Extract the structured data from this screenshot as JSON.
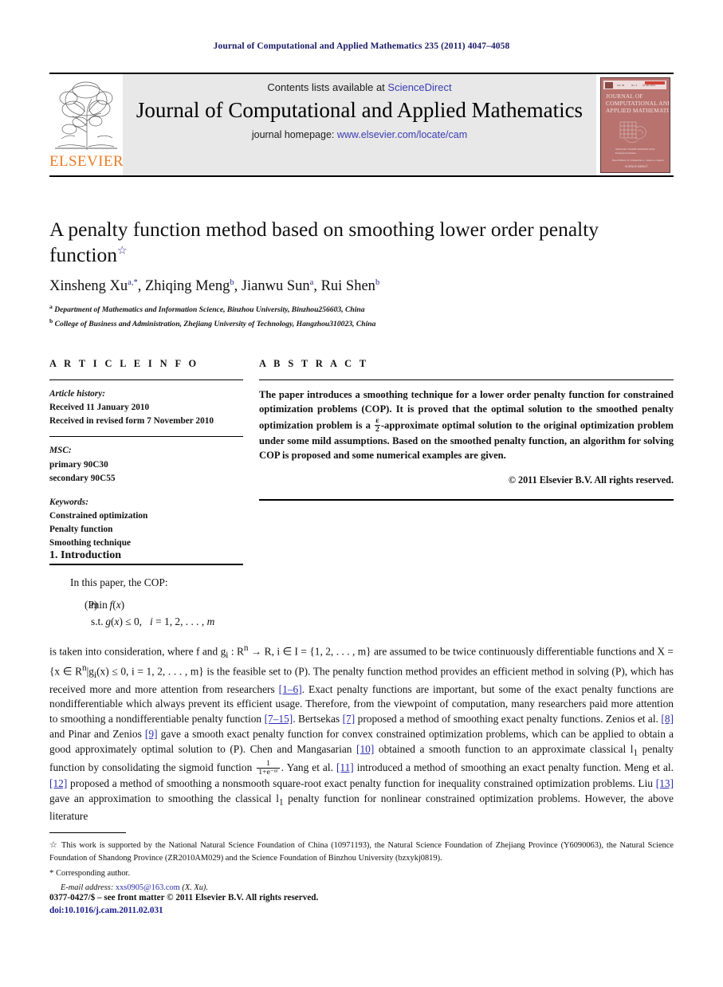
{
  "running_head": "Journal of Computational and Applied Mathematics 235 (2011) 4047–4058",
  "masthead": {
    "contents_prefix": "Contents lists available at ",
    "sciencedirect": "ScienceDirect",
    "journal_title": "Journal of Computational and Applied Mathematics",
    "homepage_prefix": "journal homepage: ",
    "homepage_url": "www.elsevier.com/locate/cam",
    "publisher": "ELSEVIER",
    "cover_title_line1": "JOURNAL OF",
    "cover_title_line2": "COMPUTATIONAL AND",
    "cover_title_line3": "APPLIED MATHEMATICS",
    "cover_caption": "Sixth Issue: Scientific Reliability Series Evaluation Problems",
    "cover_editors": "Based Editors: R. Schumacher, L. Teano, A. Veselov",
    "cover_footer": "SCIENCE DIRECT",
    "accent_link_color": "#3b3bb5",
    "elsevier_orange": "#ec7c26"
  },
  "article": {
    "title": "A penalty function method based on smoothing lower order penalty function",
    "title_star": "☆",
    "authors": [
      {
        "name": "Xinsheng Xu",
        "sup": "a,*"
      },
      {
        "name": "Zhiqing Meng",
        "sup": "b"
      },
      {
        "name": "Jianwu Sun",
        "sup": "a"
      },
      {
        "name": "Rui Shen",
        "sup": "b"
      }
    ],
    "affiliations": [
      {
        "marker": "a",
        "text": "Department of Mathematics and Information Science, Binzhou University, Binzhou256603, China"
      },
      {
        "marker": "b",
        "text": "College of Business and Administration, Zhejiang University of Technology, Hangzhou310023, China"
      }
    ]
  },
  "article_info": {
    "heading": "A R T I C L E    I N F O",
    "history_label": "Article history:",
    "history": [
      "Received 11 January 2010",
      "Received in revised form 7 November 2010"
    ],
    "msc_label": "MSC:",
    "msc": [
      "primary 90C30",
      "secondary 90C55"
    ],
    "keywords_label": "Keywords:",
    "keywords": [
      "Constrained optimization",
      "Penalty function",
      "Smoothing technique"
    ]
  },
  "abstract": {
    "heading": "A B S T R A C T",
    "text_part1": "The paper introduces a smoothing technique for a lower order penalty function for constrained optimization problems (COP). It is proved that the optimal solution to the smoothed penalty optimization problem is a ",
    "frac_num": "ε",
    "frac_den": "2",
    "text_part2": "-approximate optimal solution to the original optimization problem under some mild assumptions. Based on the smoothed penalty function, an algorithm for solving COP is proposed and some numerical examples are given.",
    "copyright": "© 2011 Elsevier B.V. All rights reserved."
  },
  "body": {
    "section_number": "1.",
    "section_title": "Introduction",
    "intro_lead": "In this paper, the COP:",
    "equation": {
      "tag": "(P)",
      "line1": "min f(x)",
      "line2_pre": "s.t. g(x) ≤ 0,",
      "line2_post": "i = 1, 2, . . . , m"
    },
    "paragraph_segments": [
      {
        "type": "text",
        "value": "is taken into consideration, where f and g"
      },
      {
        "type": "sub",
        "value": "i"
      },
      {
        "type": "text",
        "value": " : R"
      },
      {
        "type": "sup",
        "value": "n"
      },
      {
        "type": "text",
        "value": " → R, i ∈ I = {1, 2, . . . , m} are assumed to be twice continuously differentiable functions and X = {x ∈ R"
      },
      {
        "type": "sup",
        "value": "n"
      },
      {
        "type": "text",
        "value": "|g"
      },
      {
        "type": "sub",
        "value": "i"
      },
      {
        "type": "text",
        "value": "(x) ≤ 0, i = 1, 2, . . . , m} is the feasible set to (P). The penalty function method provides an efficient method in solving (P), which has received more and more attention from researchers "
      },
      {
        "type": "ref",
        "value": "[1–6]"
      },
      {
        "type": "text",
        "value": ". Exact penalty functions are important, but some of the exact penalty functions are nondifferentiable which always prevent its efficient usage. Therefore, from the viewpoint of computation, many researchers paid more attention to smoothing a nondifferentiable penalty function "
      },
      {
        "type": "ref",
        "value": "[7–15]"
      },
      {
        "type": "text",
        "value": ". Bertsekas "
      },
      {
        "type": "ref",
        "value": "[7]"
      },
      {
        "type": "text",
        "value": " proposed a method of smoothing exact penalty functions. Zenios et al. "
      },
      {
        "type": "ref",
        "value": "[8]"
      },
      {
        "type": "text",
        "value": " and Pinar and Zenios "
      },
      {
        "type": "ref",
        "value": "[9]"
      },
      {
        "type": "text",
        "value": " gave a smooth exact penalty function for convex constrained optimization problems, which can be applied to obtain a good approximately optimal solution to (P). Chen and Mangasarian "
      },
      {
        "type": "ref",
        "value": "[10]"
      },
      {
        "type": "text",
        "value": " obtained a smooth function to an approximate classical l"
      },
      {
        "type": "sub",
        "value": "1"
      },
      {
        "type": "text",
        "value": " penalty function by consolidating the sigmoid function "
      },
      {
        "type": "frac",
        "num": "1",
        "den": "1+e⁻ᵅᵗ"
      },
      {
        "type": "text",
        "value": ". Yang et al. "
      },
      {
        "type": "ref",
        "value": "[11]"
      },
      {
        "type": "text",
        "value": " introduced a method of smoothing an exact penalty function. Meng et al. "
      },
      {
        "type": "ref",
        "value": "[12]"
      },
      {
        "type": "text",
        "value": " proposed a method of smoothing a nonsmooth square-root exact penalty function for inequality constrained optimization problems. Liu "
      },
      {
        "type": "ref",
        "value": "[13]"
      },
      {
        "type": "text",
        "value": " gave an approximation to smoothing the classical l"
      },
      {
        "type": "sub",
        "value": "1"
      },
      {
        "type": "text",
        "value": " penalty function for nonlinear constrained optimization problems. However, the above literature"
      }
    ]
  },
  "footnotes": {
    "funding_marker": "☆",
    "funding": "This work is supported by the National Natural Science Foundation of China (10971193), the Natural Science Foundation of Zhejiang Province (Y6090063), the Natural Science Foundation of Shandong Province (ZR2010AM029) and the Science Foundation of Binzhou University (bzxykj0819).",
    "corresponding_marker": "*",
    "corresponding": "Corresponding author.",
    "email_label": "E-mail address:",
    "email": "xxs0905@163.com",
    "email_attrib": "(X. Xu)."
  },
  "footer": {
    "issn_line": "0377-0427/$ – see front matter © 2011 Elsevier B.V. All rights reserved.",
    "doi_line": "doi:10.1016/j.cam.2011.02.031"
  }
}
